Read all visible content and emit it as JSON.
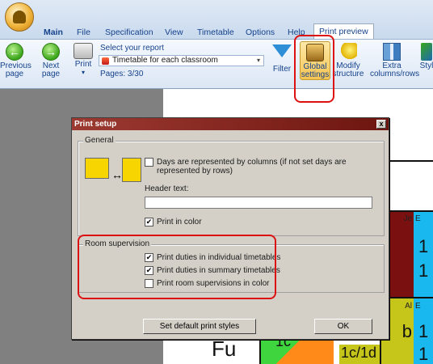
{
  "tabs": [
    "Main",
    "File",
    "Specification",
    "View",
    "Timetable",
    "Options",
    "Help",
    "Print preview"
  ],
  "ribbon": {
    "previous_page": "Previous page",
    "next_page": "Next page",
    "print": "Print",
    "select_report": "Select your report",
    "report_value": "Timetable for each classroom",
    "pages": "Pages: 3/30",
    "filter": "Filter",
    "global_settings": "Global settings",
    "modify_structure": "Modify structure",
    "extra_columns": "Extra columns/rows",
    "styles": "Styl"
  },
  "preview_cells": {
    "je": "Je",
    "e1": "E",
    "big1": "1",
    "big2": "1",
    "al": "Al",
    "e2": "E",
    "b": "b",
    "big3": "1",
    "fu": "Fu",
    "c": "1c",
    "cd": "1c/1d",
    "big4": "1"
  },
  "dialog": {
    "title": "Print setup",
    "close": "x",
    "general_legend": "General",
    "days_columns": "Days are represented by columns (if not set days are represented by rows)",
    "header_text_label": "Header text:",
    "header_text_value": "",
    "print_in_color": "Print in color",
    "room_legend": "Room supervision",
    "print_individual": "Print duties in individual timetables",
    "print_summary": "Print duties in summary timetables",
    "print_room_color": "Print room supervisions in color",
    "set_default": "Set default print styles",
    "ok": "OK"
  },
  "checkbox_states": {
    "days_columns": false,
    "print_in_color": true,
    "print_individual": true,
    "print_summary": true,
    "print_room_color": false
  },
  "colors": {
    "highlight": "#dd1111",
    "dialog_title": "#8b2a22"
  }
}
